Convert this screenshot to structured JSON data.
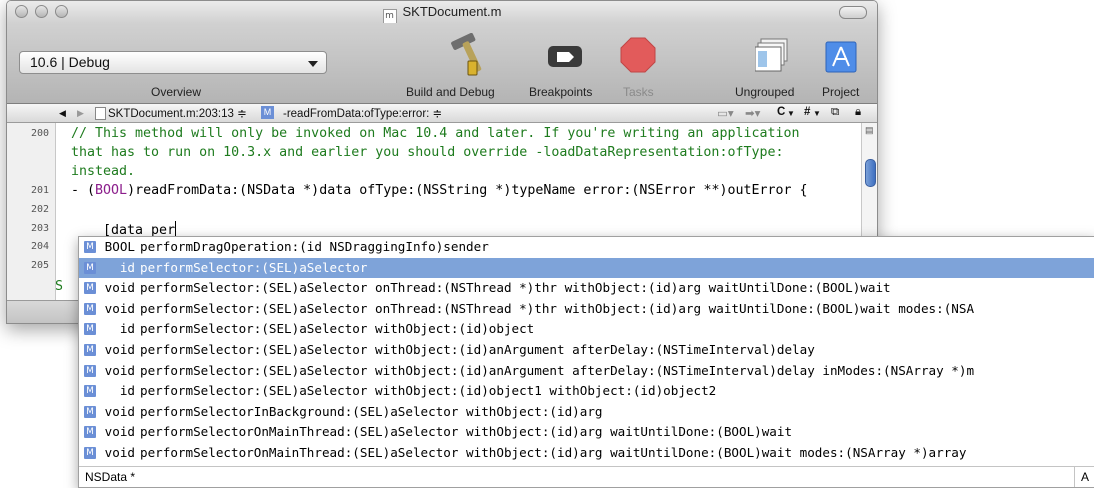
{
  "window": {
    "title": "SKTDocument.m"
  },
  "toolbar": {
    "overview_value": "10.6 | Debug",
    "overview_label": "Overview",
    "build_debug_label": "Build and Debug",
    "breakpoints_label": "Breakpoints",
    "tasks_label": "Tasks",
    "ungrouped_label": "Ungrouped",
    "project_label": "Project"
  },
  "pathbar": {
    "file_location": "SKTDocument.m:203:13 ≑",
    "method_badge": "M",
    "method": "-readFromData:ofType:error: ≑",
    "right_controls": [
      "C",
      "#"
    ]
  },
  "editor": {
    "gutter": [
      "200",
      "201",
      "202",
      "203",
      "204",
      "205"
    ],
    "comment_lines": [
      "// This method will only be invoked on Mac 10.4 and later. If you're writing an application",
      "that has to run on 10.3.x and earlier you should override -loadDataRepresentation:ofType:",
      "instead."
    ],
    "signature_prefix": "- (",
    "signature_type": "BOOL",
    "signature_rest": ")readFromData:(NSData *)data ofType:(NSString *)typeName error:(NSError **)outError {",
    "typing_line": "    [data per"
  },
  "completion": {
    "badge": "M",
    "selected_index": 1,
    "items": [
      {
        "return_type": "BOOL",
        "signature": "performDragOperation:(id NSDraggingInfo)sender"
      },
      {
        "return_type": "id",
        "signature": "performSelector:(SEL)aSelector"
      },
      {
        "return_type": "void",
        "signature": "performSelector:(SEL)aSelector onThread:(NSThread *)thr withObject:(id)arg waitUntilDone:(BOOL)wait"
      },
      {
        "return_type": "void",
        "signature": "performSelector:(SEL)aSelector onThread:(NSThread *)thr withObject:(id)arg waitUntilDone:(BOOL)wait modes:(NSA"
      },
      {
        "return_type": "id",
        "signature": "performSelector:(SEL)aSelector withObject:(id)object"
      },
      {
        "return_type": "void",
        "signature": "performSelector:(SEL)aSelector withObject:(id)anArgument afterDelay:(NSTimeInterval)delay"
      },
      {
        "return_type": "void",
        "signature": "performSelector:(SEL)aSelector withObject:(id)anArgument afterDelay:(NSTimeInterval)delay inModes:(NSArray *)m"
      },
      {
        "return_type": "id",
        "signature": "performSelector:(SEL)aSelector withObject:(id)object1 withObject:(id)object2"
      },
      {
        "return_type": "void",
        "signature": "performSelectorInBackground:(SEL)aSelector withObject:(id)arg"
      },
      {
        "return_type": "void",
        "signature": "performSelectorOnMainThread:(SEL)aSelector withObject:(id)arg waitUntilDone:(BOOL)wait"
      },
      {
        "return_type": "void",
        "signature": "performSelectorOnMainThread:(SEL)aSelector withObject:(id)arg waitUntilDone:(BOOL)wait modes:(NSArray *)array"
      }
    ],
    "status_type": "NSData *",
    "status_right": "A"
  },
  "colors": {
    "comment": "#1e7b1e",
    "keyword": "#8b1d8b",
    "selection": "#7ea3d9",
    "badge": "#6b8fd6"
  }
}
